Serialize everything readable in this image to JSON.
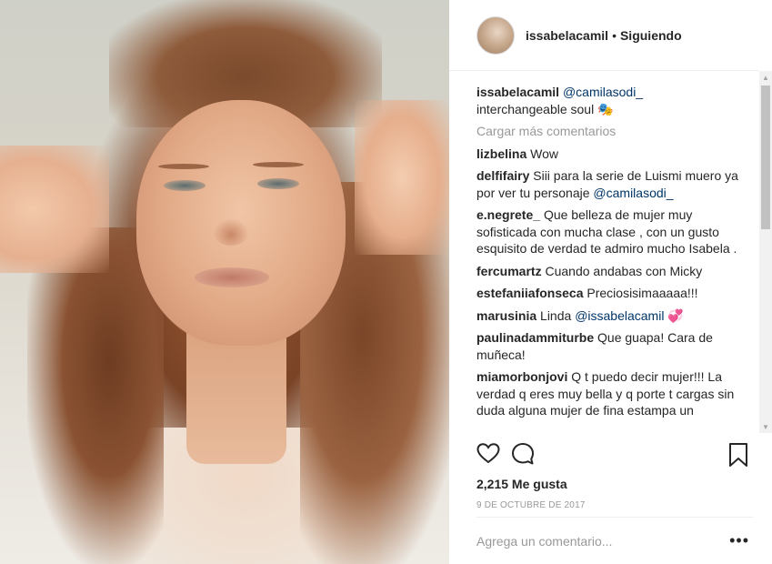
{
  "post": {
    "author": "issabelacamil",
    "separator": "•",
    "follow_status": "Siguiendo"
  },
  "caption": {
    "user": "issabelacamil",
    "mention": "@camilasodi_",
    "text": "interchangeable soul 🎭"
  },
  "load_more": "Cargar más comentarios",
  "comments": [
    {
      "user": "lizbelina",
      "text": "Wow"
    },
    {
      "user": "delfifairy",
      "text": "Siii para la serie de Luismi muero ya por ver tu personaje ",
      "mention": "@camilasodi_"
    },
    {
      "user": "e.negrete_",
      "text": "Que belleza de mujer muy sofisticada con mucha clase , con un gusto esquisito de verdad te admiro mucho Isabela ."
    },
    {
      "user": "fercumartz",
      "text": "Cuando andabas con Micky"
    },
    {
      "user": "estefaniiafonseca",
      "text": "Preciosisimaaaaa!!!"
    },
    {
      "user": "marusinia",
      "text": "Linda ",
      "mention": "@issabelacamil",
      "emoji": "💞"
    },
    {
      "user": "paulinadammiturbe",
      "text": "Que guapa! Cara de muñeca!"
    },
    {
      "user": "miamorbonjovi",
      "text": "Q t puedo decir mujer!!! La verdad q eres muy bella y q porte t cargas sin duda alguna mujer de fina estampa un"
    }
  ],
  "likes": "2,215 Me gusta",
  "date": "9 DE OCTUBRE DE 2017",
  "add_comment_placeholder": "Agrega un comentario...",
  "more_options": "•••",
  "icons": {
    "like": "heart-icon",
    "comment": "comment-bubble-icon",
    "save": "bookmark-icon"
  },
  "colors": {
    "mention": "#003569",
    "muted": "#999999",
    "text": "#262626",
    "border": "#efefef"
  }
}
